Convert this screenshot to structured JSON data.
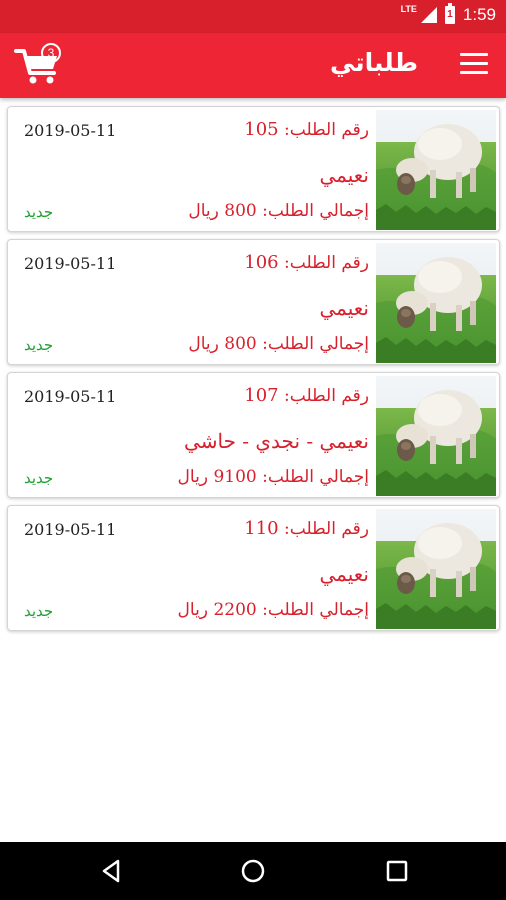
{
  "status_bar": {
    "network": "LTE",
    "battery_level": "1",
    "time": "1:59"
  },
  "app_bar": {
    "title": "طلباتي",
    "cart_count": "3"
  },
  "labels": {
    "order_no": "رقم الطلب:",
    "total": "إجمالي الطلب:",
    "currency": "ريال"
  },
  "orders": [
    {
      "date": "2019-05-11",
      "number": "105",
      "items": "نعيمي",
      "total": "800",
      "status": "جديد"
    },
    {
      "date": "2019-05-11",
      "number": "106",
      "items": "نعيمي",
      "total": "800",
      "status": "جديد"
    },
    {
      "date": "2019-05-11",
      "number": "107",
      "items": "نعيمي - نجدي - حاشي",
      "total": "9100",
      "status": "جديد"
    },
    {
      "date": "2019-05-11",
      "number": "110",
      "items": "نعيمي",
      "total": "2200",
      "status": "جديد"
    }
  ],
  "colors": {
    "primary": "#ed2535",
    "status_bar": "#d8202c",
    "price": "#d8202c",
    "status_new": "#20a032"
  }
}
